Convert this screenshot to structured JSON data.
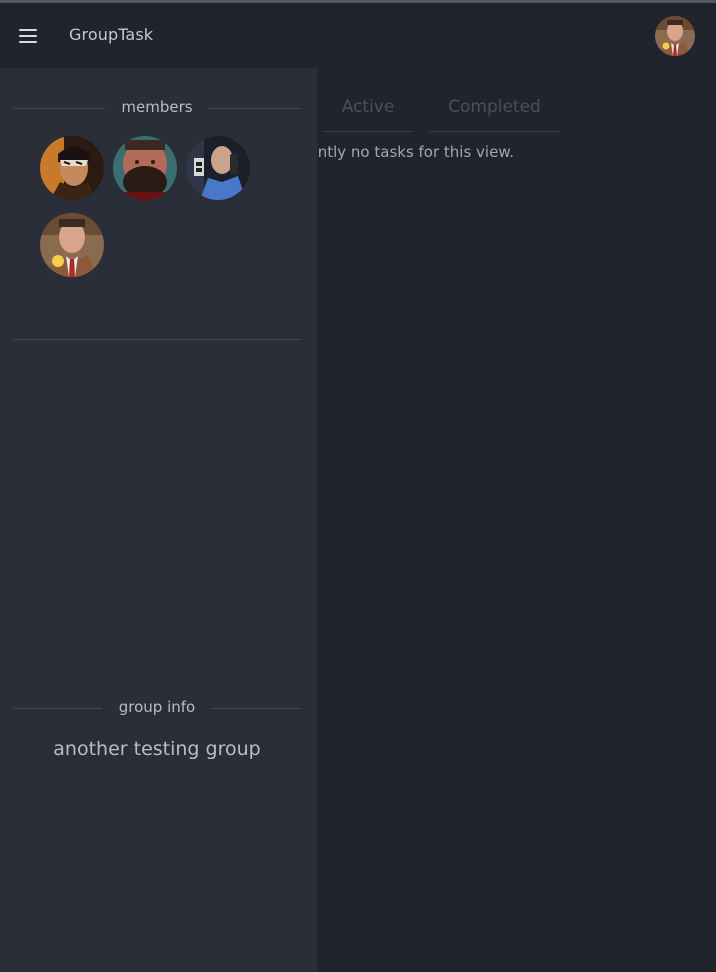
{
  "app": {
    "title": "GroupTask"
  },
  "header": {
    "menu_icon": "hamburger-menu-icon",
    "user_avatar": "user-avatar"
  },
  "tabs": [
    {
      "label": "Active"
    },
    {
      "label": "Completed"
    }
  ],
  "main": {
    "empty_message": "There are currently no tasks for this view."
  },
  "drawer": {
    "members_label": "members",
    "members": [
      {
        "avatar": "member-avatar"
      },
      {
        "avatar": "member-avatar"
      },
      {
        "avatar": "member-avatar"
      },
      {
        "avatar": "member-avatar"
      }
    ],
    "group_info_label": "group info",
    "group_name": "another testing group"
  },
  "colors": {
    "background": "#21242d",
    "drawer": "#2a2e39",
    "text": "#c5c8cf",
    "muted_tab": "#4b4f59",
    "divider": "#444855"
  }
}
